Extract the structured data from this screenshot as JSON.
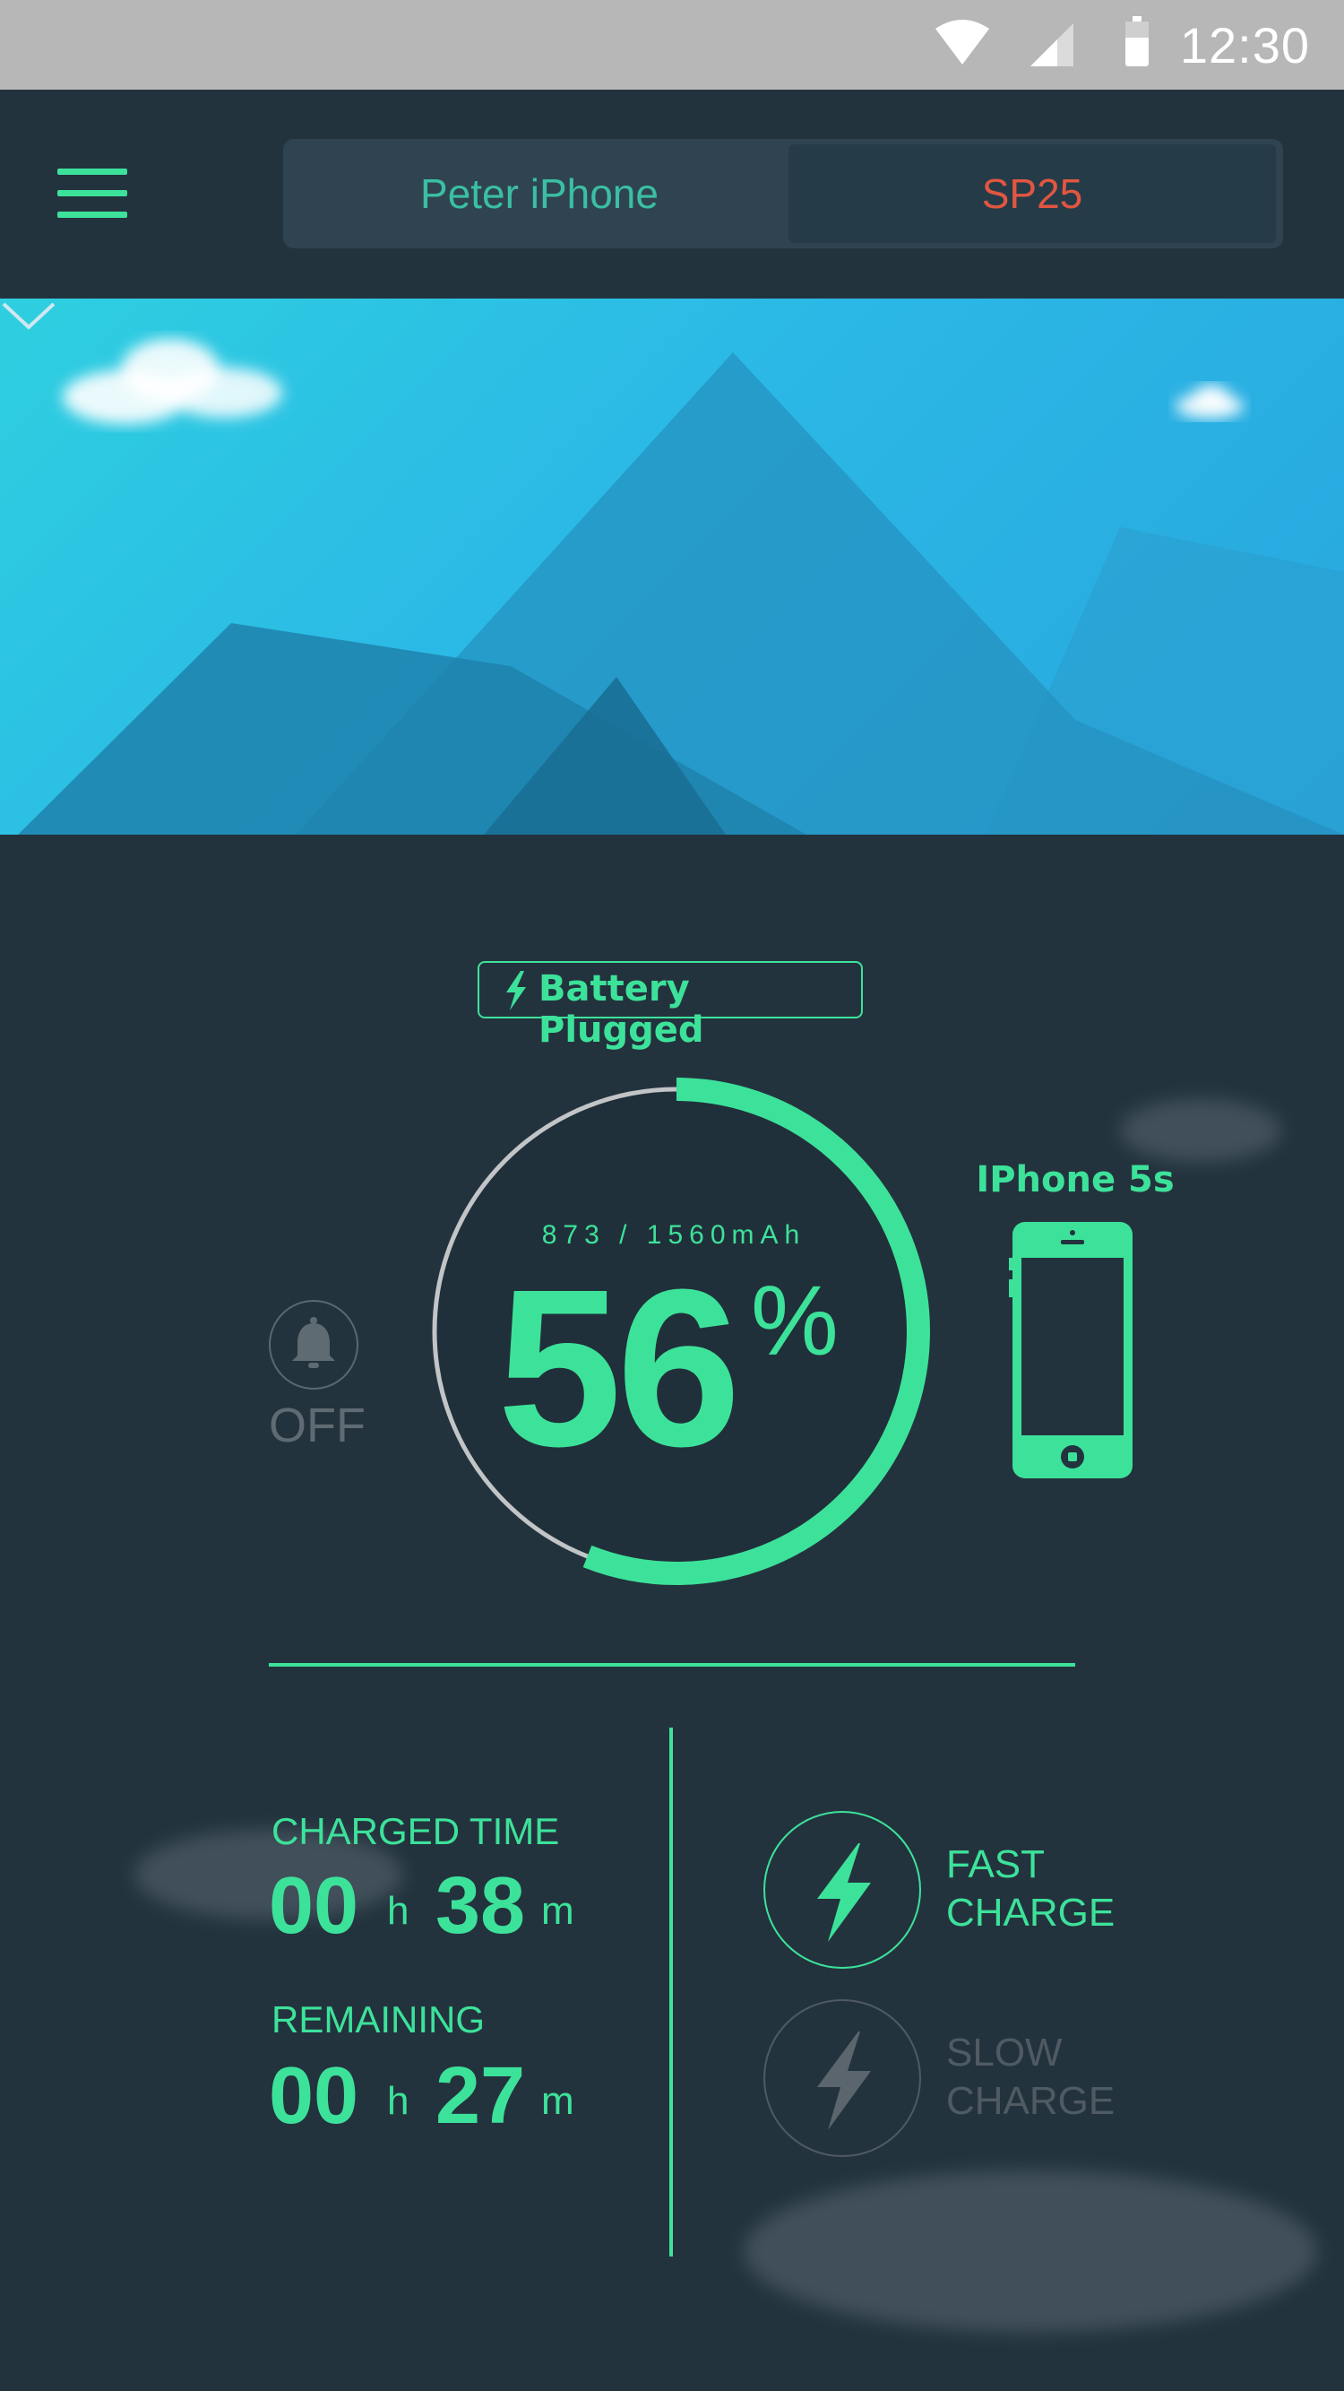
{
  "status_bar": {
    "time": "12:30",
    "icons": [
      "wifi-icon",
      "signal-icon",
      "battery-icon"
    ]
  },
  "header": {
    "menu_icon": "hamburger-icon",
    "tabs": [
      {
        "label": "Peter iPhone"
      },
      {
        "label": "SP25"
      }
    ],
    "active_tab": 1
  },
  "hero": {
    "expand_icon": "chevron-down-icon"
  },
  "battery": {
    "status_label": "Battery Plugged",
    "capacity_text": "873 / 1560mAh",
    "percent": "56",
    "percent_sign": "%",
    "level": 0.56
  },
  "alarm": {
    "icon": "bell-icon",
    "state": "OFF"
  },
  "device": {
    "name": "IPhone 5s",
    "icon": "smartphone-icon"
  },
  "stats": {
    "charged_time": {
      "label": "CHARGED TIME",
      "hours": "00",
      "hours_unit": "h",
      "minutes": "38",
      "minutes_unit": "m"
    },
    "remaining": {
      "label": "REMAINING",
      "hours": "00",
      "hours_unit": "h",
      "minutes": "27",
      "minutes_unit": "m"
    }
  },
  "charge_modes": {
    "fast": {
      "line1": "FAST",
      "line2": "CHARGE",
      "active": true
    },
    "slow": {
      "line1": "SLOW",
      "line2": "CHARGE",
      "active": false
    }
  },
  "colors": {
    "accent": "#3de29a",
    "background": "#23333e",
    "inactive": "#4f5a62",
    "alert": "#e15641"
  }
}
